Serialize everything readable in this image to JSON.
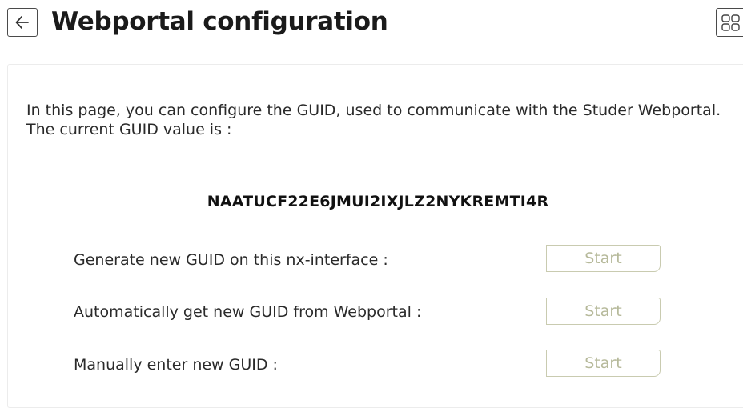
{
  "header": {
    "back_icon": "arrow-left-icon",
    "title": "Webportal configuration",
    "menu_icon": "grid-menu-icon"
  },
  "content": {
    "intro": "In this page, you can configure the GUID, used to communicate with the Studer Webportal. The current GUID value is :",
    "guid": "NAATUCF22E6JMUI2IXJLZ2NYKREMTI4R",
    "actions": [
      {
        "label": "Generate new GUID on this nx-interface :",
        "button": "Start"
      },
      {
        "label": "Automatically get new GUID from Webportal :",
        "button": "Start"
      },
      {
        "label": "Manually enter new GUID :",
        "button": "Start"
      }
    ]
  },
  "colors": {
    "button_border": "#c9cbb0",
    "button_text": "#b6b99a",
    "text": "#2a2a2a"
  }
}
